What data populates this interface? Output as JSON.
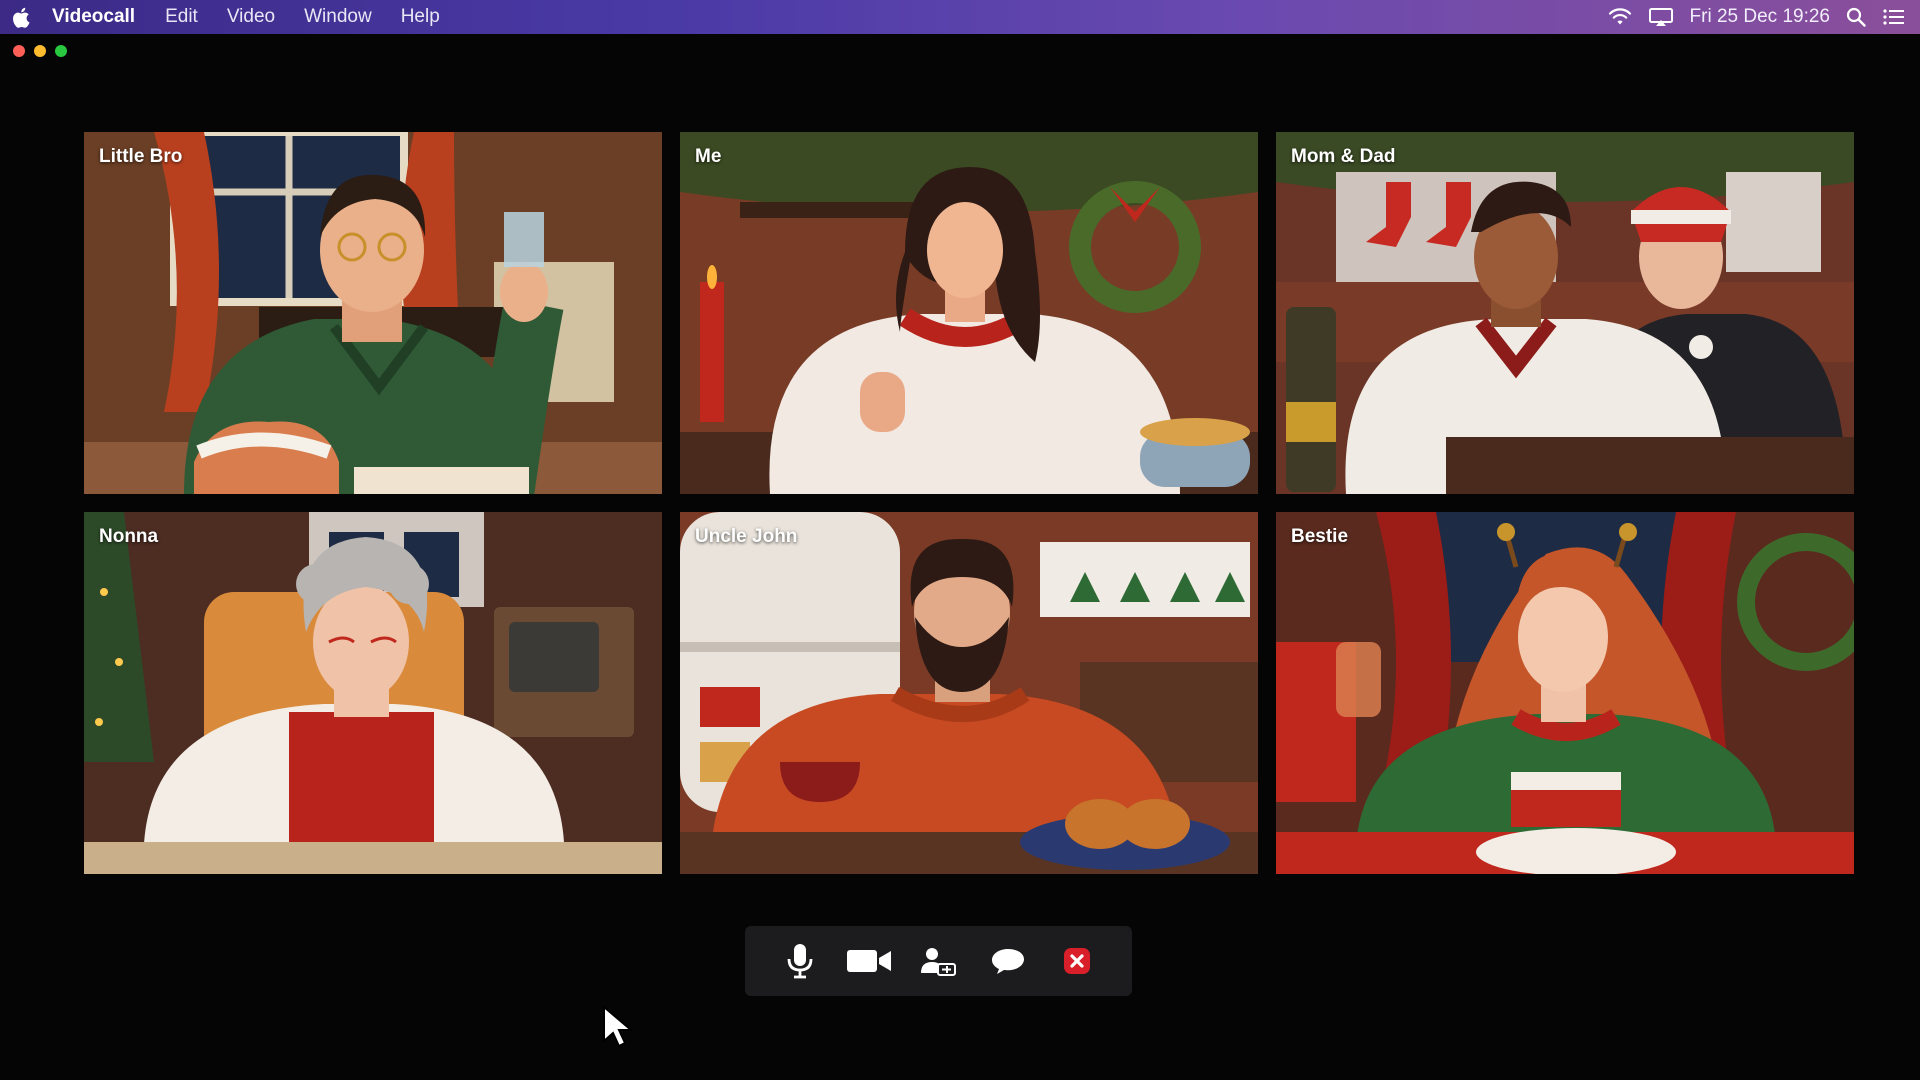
{
  "menubar": {
    "icon": "apple-icon",
    "app_name": "Videocall",
    "menus": [
      "Edit",
      "Video",
      "Window",
      "Help"
    ],
    "status_icons": [
      "wifi-icon",
      "airplay-icon",
      "search-icon",
      "list-icon"
    ],
    "clock": "Fri 25 Dec 19:26"
  },
  "participants": [
    {
      "name": "Little Bro"
    },
    {
      "name": "Me"
    },
    {
      "name": "Mom & Dad"
    },
    {
      "name": "Nonna"
    },
    {
      "name": "Uncle John"
    },
    {
      "name": "Bestie"
    }
  ],
  "controls": [
    {
      "icon": "microphone-icon"
    },
    {
      "icon": "camera-icon"
    },
    {
      "icon": "add-participant-icon"
    },
    {
      "icon": "chat-icon"
    },
    {
      "icon": "end-call-icon",
      "color": "#d81f2a"
    }
  ],
  "colors": {
    "menubar_gradient_start": "#3c2a86",
    "menubar_gradient_end": "#8a4f9a",
    "background": "#050505",
    "end_call": "#d81f2a"
  }
}
